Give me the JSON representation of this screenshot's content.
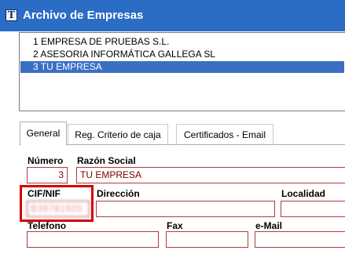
{
  "window": {
    "title": "Archivo de Empresas",
    "app_icon": "app-icon"
  },
  "companies": [
    {
      "label": "1 EMPRESA DE PRUEBAS S.L.",
      "selected": false
    },
    {
      "label": "2 ASESORIA INFORMÁTICA GALLEGA SL",
      "selected": false
    },
    {
      "label": "3 TU EMPRESA",
      "selected": true
    }
  ],
  "tabs": [
    {
      "label": "General",
      "active": true
    },
    {
      "label": "Reg. Criterio de caja",
      "active": false
    },
    {
      "label": "Certificados - Email",
      "active": false
    }
  ],
  "form": {
    "numero": {
      "label": "Número",
      "value": "3"
    },
    "razon_social": {
      "label": "Razón Social",
      "value": "TU EMPRESA"
    },
    "cif_nif": {
      "label": "CIF/NIF",
      "value": "B36781920"
    },
    "direccion": {
      "label": "Dirección",
      "value": ""
    },
    "localidad": {
      "label": "Localidad",
      "value": ""
    },
    "telefono": {
      "label": "Telefono",
      "value": ""
    },
    "fax": {
      "label": "Fax",
      "value": ""
    },
    "email": {
      "label": "e-Mail",
      "value": ""
    }
  },
  "colors": {
    "titlebar": "#2b6cc4",
    "selection": "#3a6fc4",
    "field_border": "#b23a3a",
    "highlight": "#d40000"
  }
}
